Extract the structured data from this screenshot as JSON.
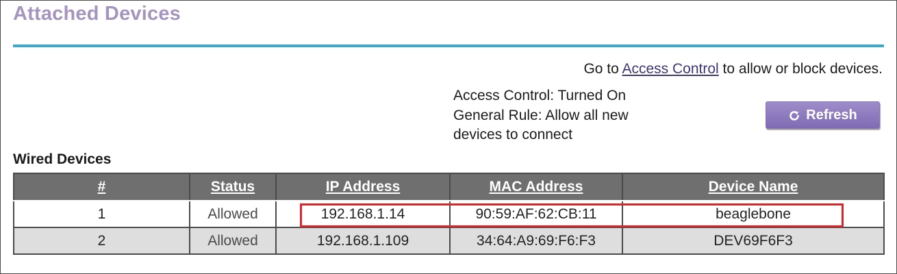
{
  "page": {
    "title": "Attached Devices"
  },
  "access": {
    "prefix": "Go to ",
    "link_label": "Access Control",
    "suffix": " to allow or block devices."
  },
  "status": {
    "access_control": "Access Control: Turned On",
    "general_rule_line1": "General Rule: Allow all new",
    "general_rule_line2": "devices to connect"
  },
  "refresh_button": {
    "label": "Refresh",
    "icon": "refresh-icon"
  },
  "wired_devices": {
    "title": "Wired Devices",
    "columns": [
      "#",
      "Status",
      "IP Address",
      "MAC Address",
      "Device Name"
    ],
    "rows": [
      {
        "num": "1",
        "status": "Allowed",
        "ip": "192.168.1.14",
        "mac": "90:59:AF:62:CB:11",
        "name": "beaglebone"
      },
      {
        "num": "2",
        "status": "Allowed",
        "ip": "192.168.1.109",
        "mac": "34:64:A9:69:F6:F3",
        "name": "DEV69F6F3"
      }
    ]
  },
  "colors": {
    "title": "#a594bd",
    "rule": "#38a9cf",
    "link": "#3d3576",
    "button": "#8e7cc0",
    "header_bg": "#6f6f6f",
    "highlight": "#d9262b"
  }
}
